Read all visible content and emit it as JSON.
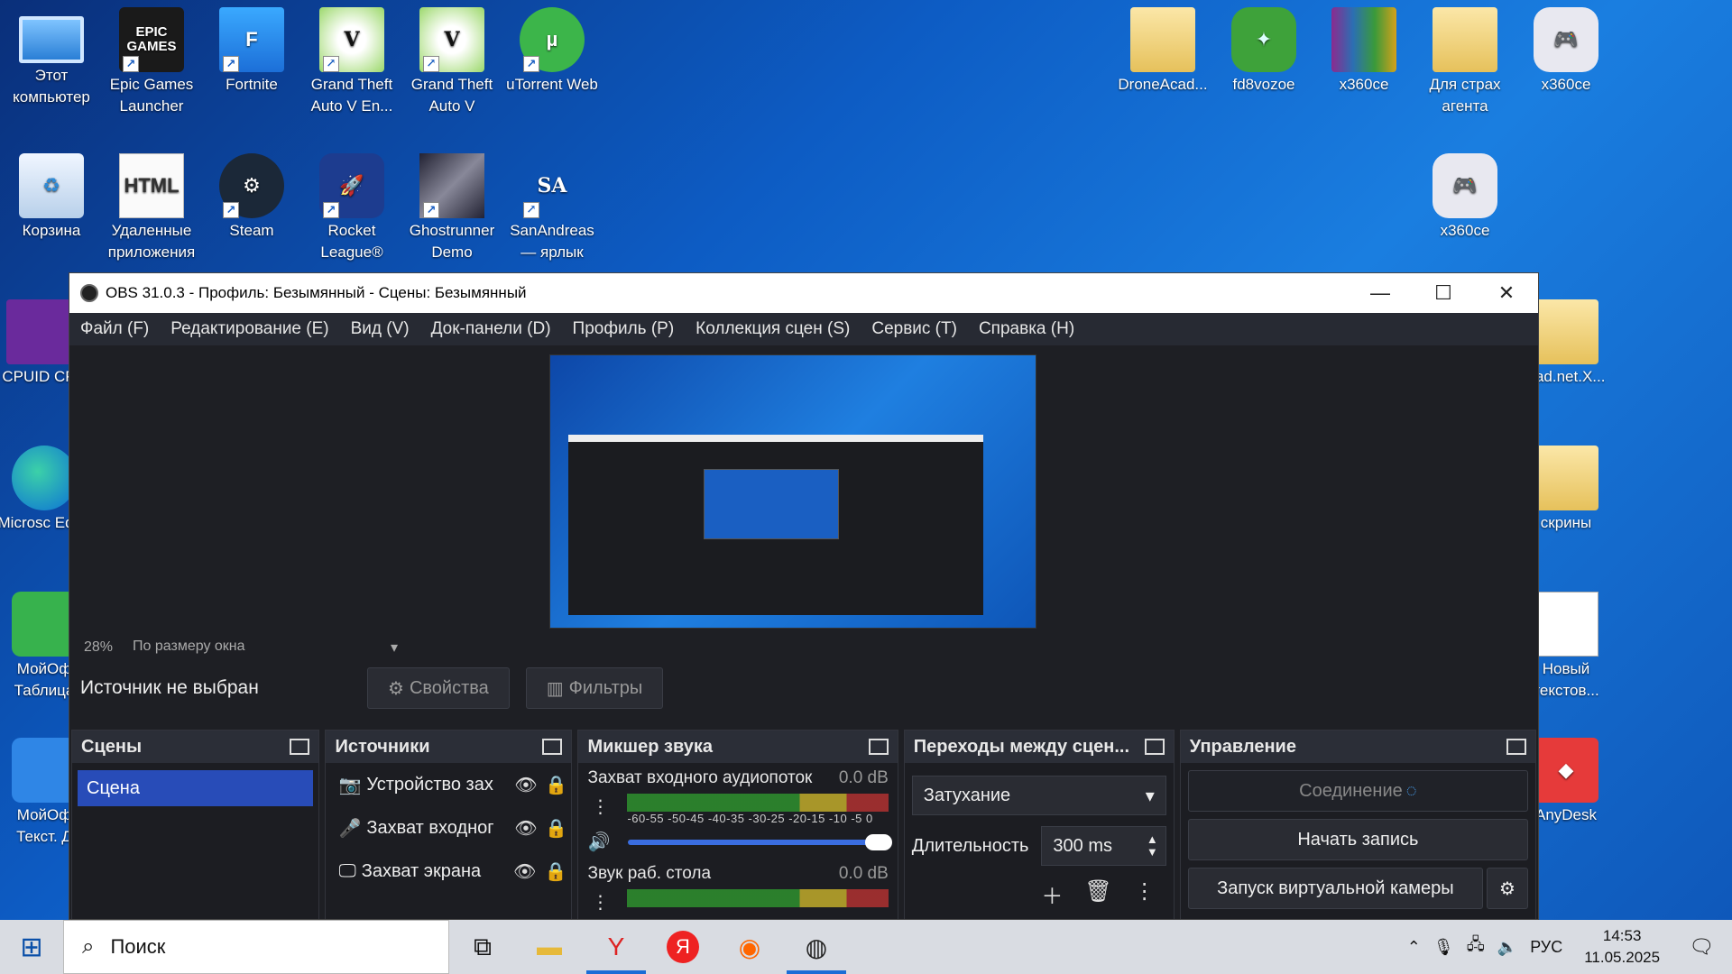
{
  "desktop": {
    "icons": [
      {
        "label": "Этот компьютер",
        "icon": "computer-icon"
      },
      {
        "label": "Epic Games Launcher",
        "icon": "epic-games-icon",
        "glyph": "EPIC GAMES"
      },
      {
        "label": "Fortnite",
        "icon": "fortnite-icon",
        "glyph": "F"
      },
      {
        "label": "Grand Theft Auto V En...",
        "icon": "gta-icon",
        "glyph": "V"
      },
      {
        "label": "Grand Theft Auto V",
        "icon": "gta-icon",
        "glyph": "V"
      },
      {
        "label": "uTorrent Web",
        "icon": "utorrent-icon",
        "glyph": "µ"
      },
      {
        "label": "DroneAcad...",
        "icon": "folder-icon"
      },
      {
        "label": "fd8vozoe",
        "icon": "drweb-icon"
      },
      {
        "label": "x360ce",
        "icon": "winrar-icon"
      },
      {
        "label": "Для страх агента",
        "icon": "folder-icon"
      },
      {
        "label": "x360ce",
        "icon": "gamepad-icon"
      },
      {
        "label": "Корзина",
        "icon": "recycle-bin-icon"
      },
      {
        "label": "Удаленные приложения",
        "icon": "html-file-icon",
        "glyph": "HTML"
      },
      {
        "label": "Steam",
        "icon": "steam-icon"
      },
      {
        "label": "Rocket League®",
        "icon": "rocket-league-icon"
      },
      {
        "label": "Ghostrunner Demo",
        "icon": "ghostrunner-icon"
      },
      {
        "label": "SanAndreas — ярлык",
        "icon": "sanandreas-icon",
        "glyph": "SA"
      },
      {
        "label": "x360ce",
        "icon": "gamepad-icon"
      },
      {
        "label": "CPUID CP",
        "icon": "cpuid-icon"
      },
      {
        "label": "oad.net.X...",
        "icon": "folder-icon"
      },
      {
        "label": "Microsc Edge",
        "icon": "edge-icon"
      },
      {
        "label": "скрины",
        "icon": "folder-icon"
      },
      {
        "label": "МойОф Таблица",
        "icon": "spreadsheet-icon"
      },
      {
        "label": "Новый текстов...",
        "icon": "text-file-icon"
      },
      {
        "label": "МойОф Текст. Д",
        "icon": "document-icon"
      },
      {
        "label": "AnyDesk",
        "icon": "anydesk-icon"
      }
    ]
  },
  "obs": {
    "title": "OBS 31.0.3 - Профиль: Безымянный - Сцены: Безымянный",
    "menu": [
      "Файл (F)",
      "Редактирование (E)",
      "Вид (V)",
      "Док-панели (D)",
      "Профиль (P)",
      "Коллекция сцен (S)",
      "Сервис (T)",
      "Справка (H)"
    ],
    "zoom": "28%",
    "zoom_mode": "По размеру окна",
    "source_status": "Источник не выбран",
    "properties_label": "Свойства",
    "filters_label": "Фильтры",
    "scenes": {
      "title": "Сцены",
      "items": [
        "Сцена"
      ]
    },
    "sources": {
      "title": "Источники",
      "items": [
        {
          "name": "Устройство зах",
          "icon": "camera-icon"
        },
        {
          "name": "Захват входног",
          "icon": "microphone-icon"
        },
        {
          "name": "Захват экрана",
          "icon": "monitor-icon"
        }
      ]
    },
    "mixer": {
      "title": "Микшер звука",
      "channels": [
        {
          "name": "Захват входного аудиопоток",
          "db": "0.0 dB",
          "level": 1.0
        },
        {
          "name": "Звук раб. стола",
          "db": "0.0 dB"
        }
      ],
      "ticks": "-60-55 -50-45 -40-35 -30-25 -20-15 -10 -5  0"
    },
    "transitions": {
      "title": "Переходы между сцен...",
      "selected": "Затухание",
      "duration_label": "Длительность",
      "duration_value": "300 ms"
    },
    "controls": {
      "title": "Управление",
      "connecting": "Соединение",
      "record": "Начать запись",
      "virtual_cam": "Запуск виртуальной камеры"
    }
  },
  "taskbar": {
    "search_placeholder": "Поиск",
    "language": "РУС",
    "time": "14:53",
    "date": "11.05.2025"
  }
}
